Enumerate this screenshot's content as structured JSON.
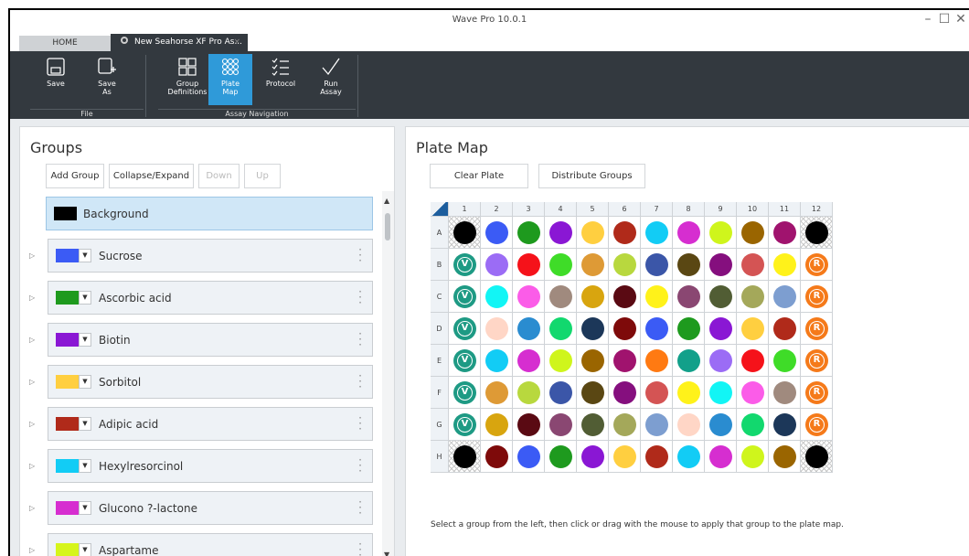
{
  "window": {
    "title": "Wave Pro 10.0.1",
    "minimize": "–",
    "maximize": "☐",
    "close": "✕"
  },
  "tabs": {
    "home": "HOME",
    "assay": "New Seahorse XF Pro As...",
    "assay_close": "×"
  },
  "ribbon": {
    "buttons": [
      {
        "label1": "Save",
        "label2": "",
        "icon": "save-icon"
      },
      {
        "label1": "Save",
        "label2": "As",
        "icon": "save-as-icon"
      },
      {
        "label1": "Group",
        "label2": "Definitions",
        "icon": "group-definitions-icon"
      },
      {
        "label1": "Plate",
        "label2": "Map",
        "icon": "plate-map-icon"
      },
      {
        "label1": "Protocol",
        "label2": "",
        "icon": "protocol-icon"
      },
      {
        "label1": "Run",
        "label2": "Assay",
        "icon": "run-assay-icon"
      }
    ],
    "groups": {
      "file": "File",
      "assay_nav": "Assay Navigation"
    },
    "active_button": "Plate Map",
    "active_color": "#2f9ad9"
  },
  "groups_pane": {
    "title": "Groups",
    "buttons": [
      "Add Group",
      "Collapse/Expand",
      "Down",
      "Up"
    ],
    "items": [
      {
        "label": "Background",
        "color": "#000000"
      },
      {
        "label": "Sucrose",
        "color": "#3b5bf5"
      },
      {
        "label": "Ascorbic acid",
        "color": "#1e9a1e"
      },
      {
        "label": "Biotin",
        "color": "#8a17d4"
      },
      {
        "label": "Sorbitol",
        "color": "#ffcf40"
      },
      {
        "label": "Adipic acid",
        "color": "#b02a1a"
      },
      {
        "label": "Hexylresorcinol",
        "color": "#12ccf5"
      },
      {
        "label": "Glucono ?-lactone",
        "color": "#d62ed0"
      },
      {
        "label": "Aspartame",
        "color": "#d6f51c"
      }
    ]
  },
  "plate_pane": {
    "title": "Plate Map",
    "buttons": [
      "Clear Plate",
      "Distribute Groups"
    ],
    "columns": [
      "1",
      "2",
      "3",
      "4",
      "5",
      "6",
      "7",
      "8",
      "9",
      "10",
      "11",
      "12"
    ],
    "rows": [
      "A",
      "B",
      "C",
      "D",
      "E",
      "F",
      "G",
      "H"
    ],
    "markers": {
      "v": "V",
      "r": "R"
    },
    "marker_colors": {
      "v": "#1e9a84",
      "r": "#f57a1a"
    },
    "wells": [
      [
        "BG",
        "#3b5bf5",
        "#1e9a1e",
        "#8a17d4",
        "#ffcf40",
        "#b02a1a",
        "#12ccf5",
        "#d62ed0",
        "#cff51c",
        "#9a6500",
        "#a0136e",
        "BG"
      ],
      [
        "V",
        "#9b6cf5",
        "#f5121a",
        "#3fdc28",
        "#de9a36",
        "#b8d83e",
        "#3b56a8",
        "#5a4713",
        "#850f7e",
        "#d45454",
        "#fff21a",
        "R"
      ],
      [
        "V",
        "#12f5f5",
        "#fb5ce8",
        "#a08a7e",
        "#d8a50f",
        "#5a0a13",
        "#fff21a",
        "#8a4772",
        "#515d34",
        "#a4a85a",
        "#7d9ed0",
        "R"
      ],
      [
        "V",
        "#ffd6c6",
        "#2a8cd0",
        "#12d86e",
        "#1c3759",
        "#7e0a0a",
        "#3b5bf5",
        "#1e9a1e",
        "#8a17d4",
        "#ffcf40",
        "#b02a1a",
        "R"
      ],
      [
        "V",
        "#12ccf5",
        "#d62ed0",
        "#cff51c",
        "#9a6500",
        "#a0136e",
        "#ff7a12",
        "#12a08a",
        "#9b6cf5",
        "#f5121a",
        "#3fdc28",
        "R"
      ],
      [
        "V",
        "#de9a36",
        "#b8d83e",
        "#3b56a8",
        "#5a4713",
        "#850f7e",
        "#d45454",
        "#fff21a",
        "#12f5f5",
        "#fb5ce8",
        "#a08a7e",
        "R"
      ],
      [
        "V",
        "#d8a50f",
        "#5a0a13",
        "#8a4772",
        "#515d34",
        "#a4a85a",
        "#7d9ed0",
        "#ffd6c6",
        "#2a8cd0",
        "#12d86e",
        "#1c3759",
        "R"
      ],
      [
        "BG",
        "#7e0a0a",
        "#3b5bf5",
        "#1e9a1e",
        "#8a17d4",
        "#ffcf40",
        "#b02a1a",
        "#12ccf5",
        "#d62ed0",
        "#cff51c",
        "#9a6500",
        "BG"
      ]
    ],
    "instruction": "Select a group from the left, then click or drag with the mouse to apply that group to the plate map."
  }
}
